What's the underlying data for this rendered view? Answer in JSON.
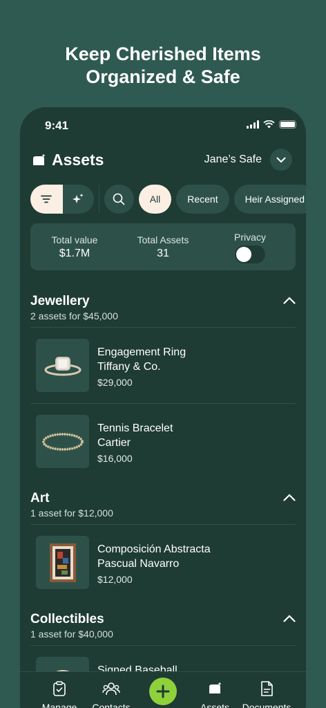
{
  "hero": {
    "line1": "Keep Cherished Items",
    "line2": "Organized & Safe"
  },
  "status": {
    "time": "9:41"
  },
  "header": {
    "title": "Assets",
    "safe_name": "Jane’s Safe"
  },
  "filters": {
    "chips": [
      "All",
      "Recent",
      "Heir Assigned"
    ],
    "active": "All"
  },
  "summary": {
    "total_value_label": "Total value",
    "total_value": "$1.7M",
    "total_assets_label": "Total Assets",
    "total_assets": "31",
    "privacy_label": "Privacy",
    "privacy_on": false
  },
  "sections": [
    {
      "title": "Jewellery",
      "subtitle": "2 assets for $45,000",
      "items": [
        {
          "name": "Engagement Ring",
          "maker": "Tiffany & Co.",
          "price": "$29,000"
        },
        {
          "name": "Tennis Bracelet",
          "maker": "Cartier",
          "price": "$16,000"
        }
      ]
    },
    {
      "title": "Art",
      "subtitle": "1 asset for $12,000",
      "items": [
        {
          "name": "Composición Abstracta",
          "maker": "Pascual Navarro",
          "price": "$12,000"
        }
      ]
    },
    {
      "title": "Collectibles",
      "subtitle": "1 asset for $40,000",
      "items": [
        {
          "name": "Signed Baseball",
          "maker": "",
          "price": ""
        }
      ]
    }
  ],
  "tabbar": {
    "tabs": [
      "Manage",
      "Contacts",
      "Assets",
      "Documents"
    ],
    "active": "Assets"
  },
  "colors": {
    "background": "#2f5a51",
    "card": "#1e3b34",
    "surface": "#2d5148",
    "accent": "#8ed13b",
    "cream": "#fbeee2"
  },
  "icons": [
    "safe-icon",
    "chevron-down-icon",
    "sort-icon",
    "sparkle-icon",
    "search-icon",
    "chevron-up-icon",
    "clipboard-icon",
    "contacts-icon",
    "plus-icon",
    "document-icon"
  ]
}
